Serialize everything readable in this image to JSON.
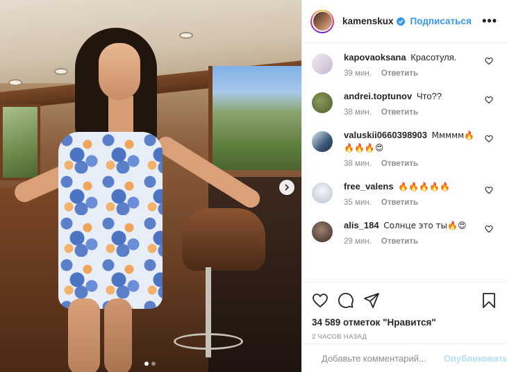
{
  "post": {
    "author": "kamenskux",
    "follow_label": "Подписаться",
    "more_label": "•••",
    "likes_text": "34 589 отметок \"Нравится\"",
    "time_ago": "2 часов назад",
    "carousel": {
      "slide_count": 2,
      "active_index": 0
    }
  },
  "comments": [
    {
      "user": "kapovaoksana",
      "text": "Красотуля.",
      "time": "39 мин.",
      "reply_label": "Ответить",
      "avatar_color": "#d8cfe0"
    },
    {
      "user": "andrei.toptunov",
      "text": "Что??",
      "time": "38 мин.",
      "reply_label": "Ответить",
      "avatar_color": "#6e7d46"
    },
    {
      "user": "valuskii0660398903",
      "text": "Ммммм🔥🔥🔥🔥😍",
      "time": "38 мин.",
      "reply_label": "Ответить",
      "avatar_color": "#4f6f8f"
    },
    {
      "user": "free_valens",
      "text": "🔥🔥🔥🔥🔥",
      "time": "35 мин.",
      "reply_label": "Ответить",
      "avatar_color": "#cfd6df"
    },
    {
      "user": "alis_184",
      "text": "Солнце это ты🔥😍",
      "time": "29 мин.",
      "reply_label": "Ответить",
      "avatar_color": "#5a4a44"
    }
  ],
  "add_comment": {
    "placeholder": "Добавьте комментарий...",
    "publish_label": "Опубликовать"
  },
  "colors": {
    "accent": "#3897f0",
    "publish_disabled": "#b2dffc",
    "muted": "#8e8e8e"
  }
}
